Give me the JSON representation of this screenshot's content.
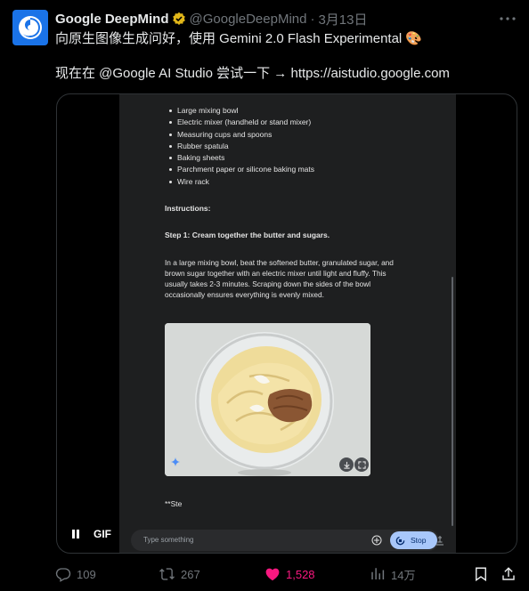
{
  "author": {
    "name": "Google DeepMind",
    "handle": "@GoogleDeepMind",
    "separator": "·",
    "date": "3月13日"
  },
  "tweet": {
    "line1": "向原生图像生成问好，使用 Gemini 2.0 Flash Experimental 🎨",
    "line2": "现在在 @Google AI Studio 尝试一下 → https://aistudio.google.com"
  },
  "gif": {
    "equipment": [
      "Large mixing bowl",
      "Electric mixer (handheld or stand mixer)",
      "Measuring cups and spoons",
      "Rubber spatula",
      "Baking sheets",
      "Parchment paper or silicone baking mats",
      "Wire rack"
    ],
    "instructions_heading": "Instructions:",
    "step1_heading": "Step 1: Cream together the butter and sugars.",
    "step1_text": "In a large mixing bowl, beat the softened butter, granulated sugar, and brown sugar together with an electric mixer until light and fluffy. This usually takes 2-3 minutes. Scraping down the sides of the bowl occasionally ensures everything is evenly mixed.",
    "partial_text": "**Ste",
    "composer_placeholder": "Type something",
    "stop_label": "Stop",
    "gif_label": "GIF"
  },
  "actions": {
    "replies": "109",
    "reposts": "267",
    "likes": "1,528",
    "views": "14万"
  },
  "colors": {
    "background": "#000000",
    "text_primary": "#e7e9ea",
    "text_secondary": "#71767b",
    "like_pink": "#f91880",
    "verified_gold": "#e2b719",
    "stop_button": "#a8c7fa"
  },
  "icons": {
    "verified": "verified-badge-icon",
    "more": "more-icon",
    "reply": "reply-icon",
    "repost": "repost-icon",
    "like": "heart-icon",
    "views": "views-icon",
    "bookmark": "bookmark-icon",
    "share": "share-icon"
  }
}
